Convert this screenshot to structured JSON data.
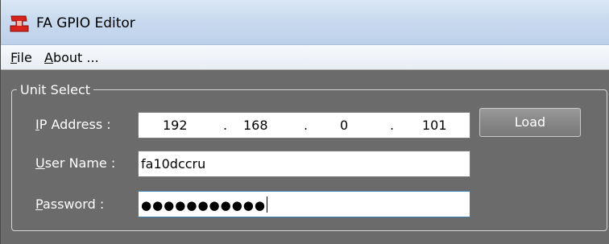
{
  "window": {
    "title": "FA GPIO Editor"
  },
  "menu": {
    "file": {
      "mnemonic": "F",
      "rest": "ile"
    },
    "about": {
      "mnemonic": "A",
      "rest": "bout ..."
    }
  },
  "unit_select": {
    "group_title": "Unit Select",
    "ip_label": {
      "mnemonic": "I",
      "rest": "P Address :"
    },
    "ip_octets": [
      "192",
      "168",
      "0",
      "101"
    ],
    "ip_separator": ".",
    "username_label": {
      "mnemonic": "U",
      "rest": "ser Name :"
    },
    "username_value": "fa10dccru",
    "password_label": {
      "mnemonic": "P",
      "rest": "assword :"
    },
    "password_mask": "●●●●●●●●●●●",
    "load_button": "Load"
  },
  "colors": {
    "client_background": "#6b6b6b",
    "titlebar": "#c9daef",
    "label_text": "#ffffff"
  },
  "icons": {
    "app": "fa-app-icon"
  }
}
